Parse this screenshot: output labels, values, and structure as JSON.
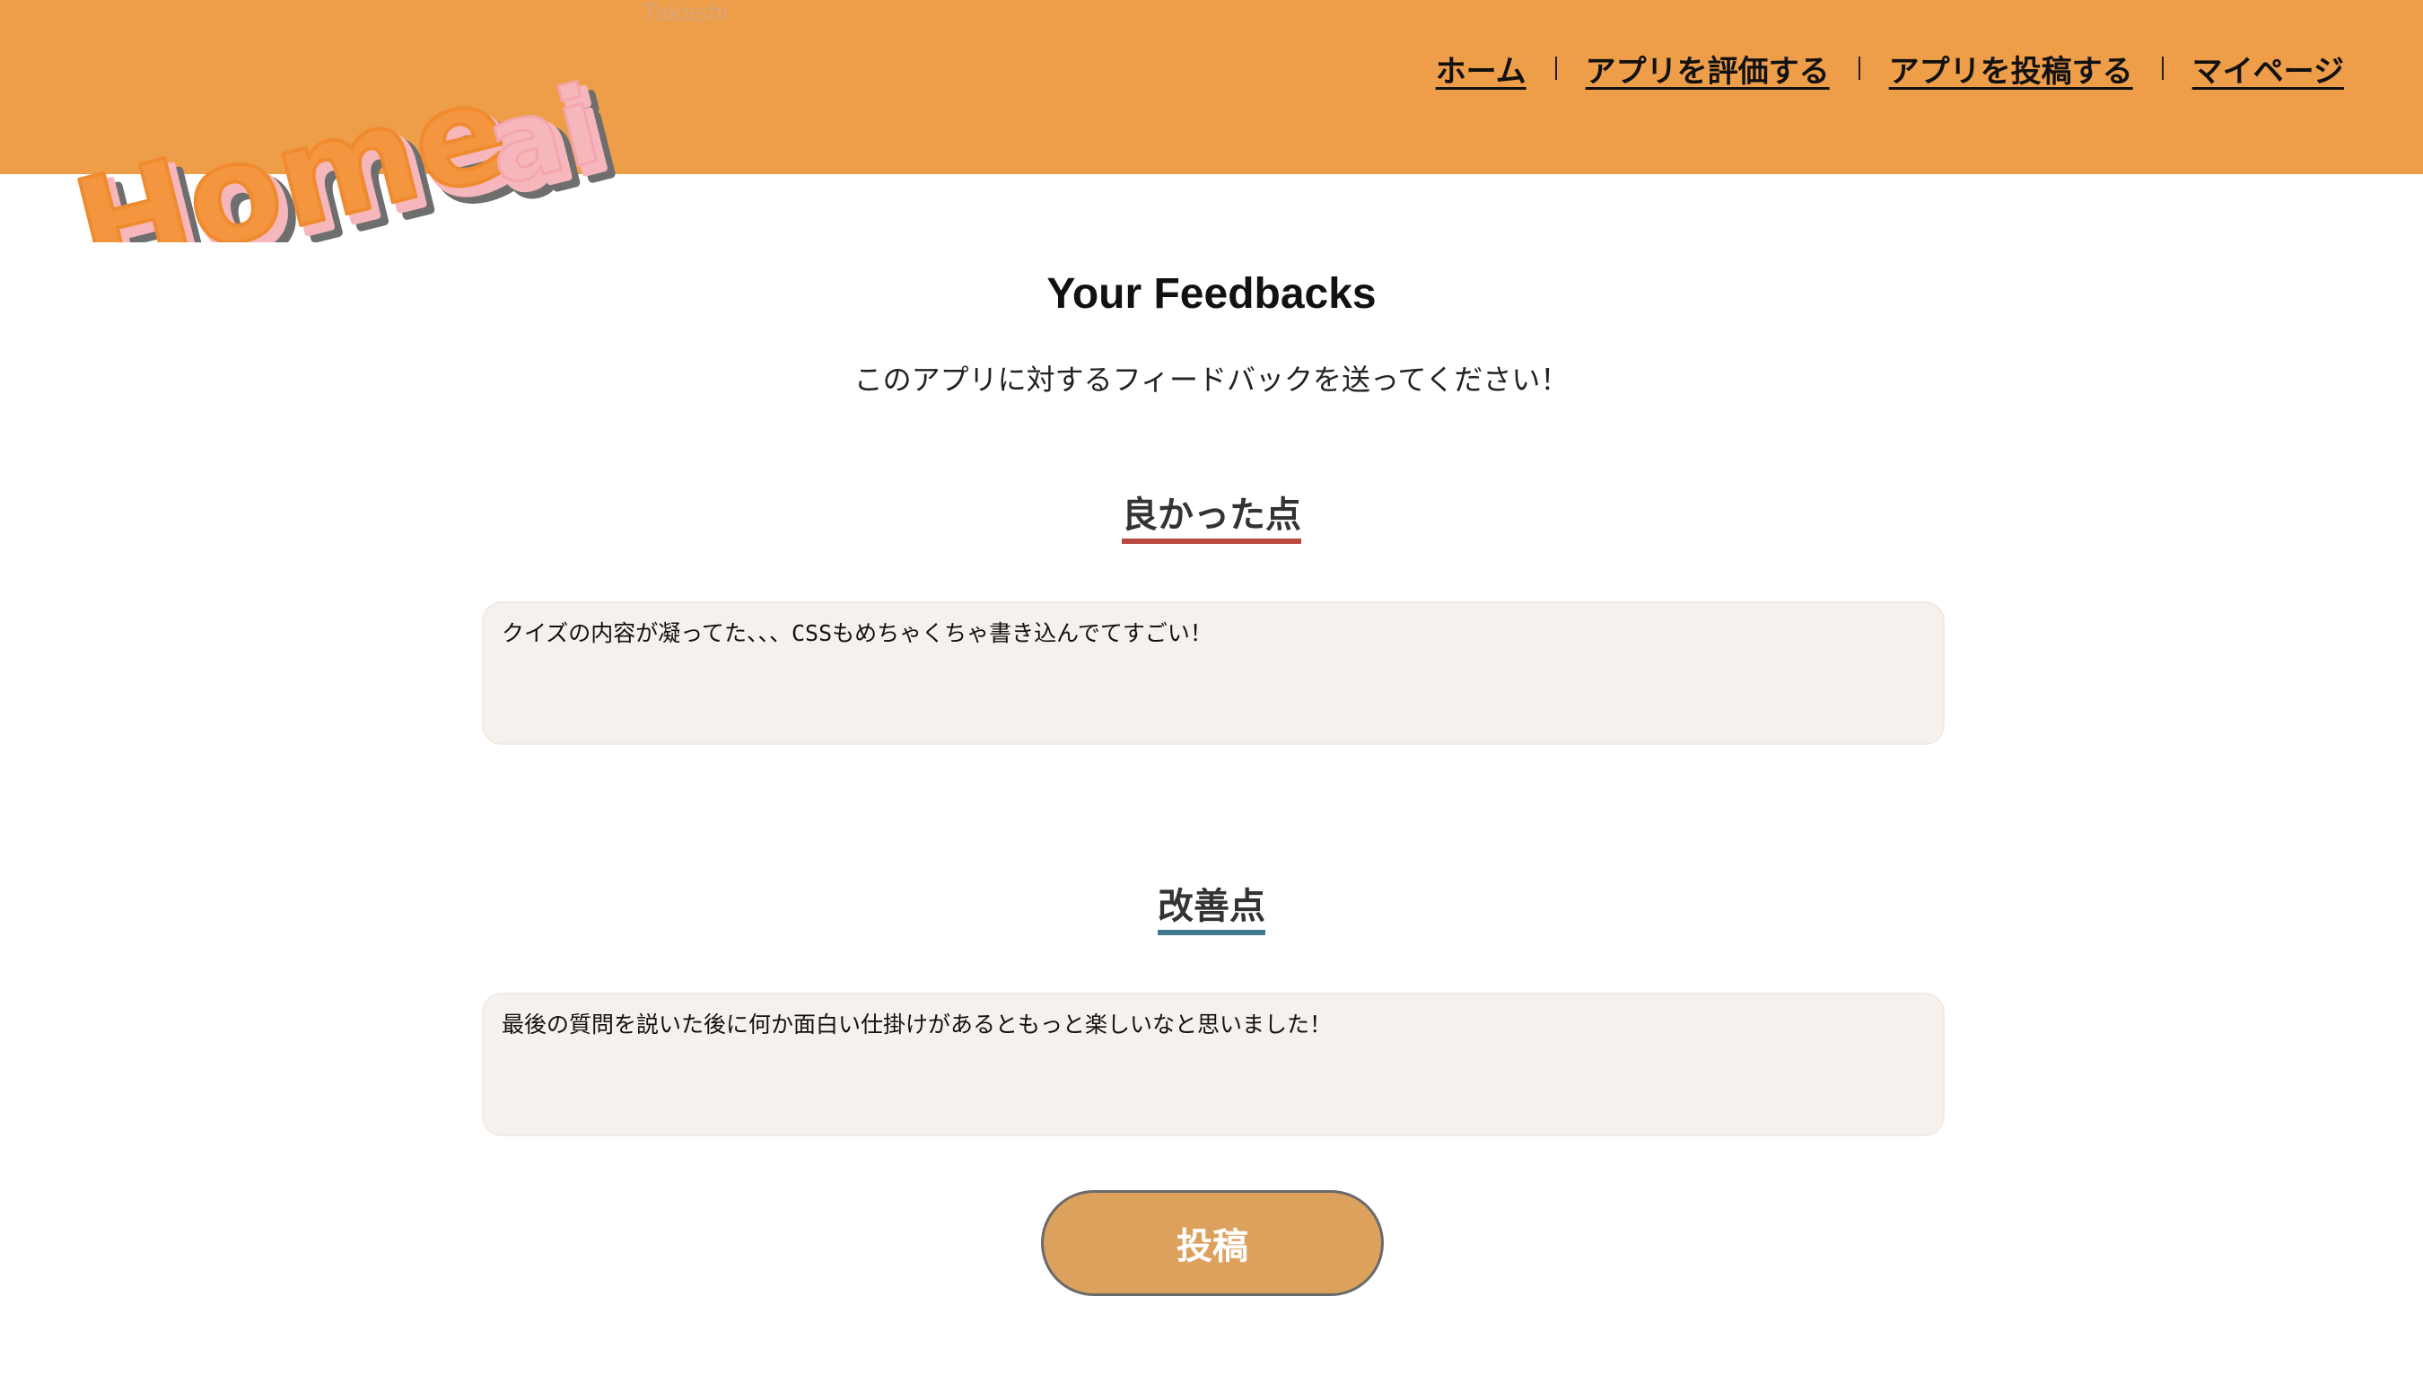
{
  "header": {
    "username": "Takashi",
    "logo_text": "Homeai",
    "background_color": "#EE9D48",
    "nav": [
      {
        "label": "ホーム"
      },
      {
        "label": "アプリを評価する"
      },
      {
        "label": "アプリを投稿する"
      },
      {
        "label": "マイページ"
      }
    ]
  },
  "main": {
    "title": "Your Feedbacks",
    "subtitle": "このアプリに対するフィードバックを送ってください！",
    "good_points": {
      "heading": "良かった点",
      "underline_color": "#B94A3F",
      "value": "クイズの内容が凝ってた、、、CSSもめちゃくちゃ書き込んでてすごい！"
    },
    "improvements": {
      "heading": "改善点",
      "underline_color": "#3F7A90",
      "value": "最後の質問を説いた後に何か面白い仕掛けがあるともっと楽しいなと思いました！"
    },
    "submit_label": "投稿",
    "submit_color": "#DDA15E"
  }
}
